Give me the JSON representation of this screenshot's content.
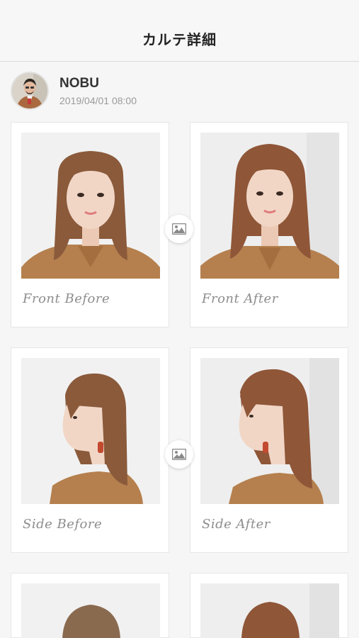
{
  "header": {
    "title": "カルテ詳細"
  },
  "profile": {
    "name": "NOBU",
    "datetime": "2019/04/01 08:00",
    "avatar_icon": "stylist-avatar-icon"
  },
  "cards": [
    {
      "label": "Front Before",
      "photo_icon": "hair-front-photo"
    },
    {
      "label": "Front After",
      "photo_icon": "hair-front-photo"
    },
    {
      "label": "Side Before",
      "photo_icon": "hair-side-photo"
    },
    {
      "label": "Side After",
      "photo_icon": "hair-side-photo"
    },
    {
      "label": "",
      "photo_icon": "hair-back-photo"
    },
    {
      "label": "",
      "photo_icon": "hair-back-photo"
    }
  ],
  "colors": {
    "background": "#f6f6f6",
    "hair": "#8a5a3b",
    "shirt": "#b5804e",
    "skin": "#f1d6c6",
    "caption": "#8d8d8d"
  }
}
